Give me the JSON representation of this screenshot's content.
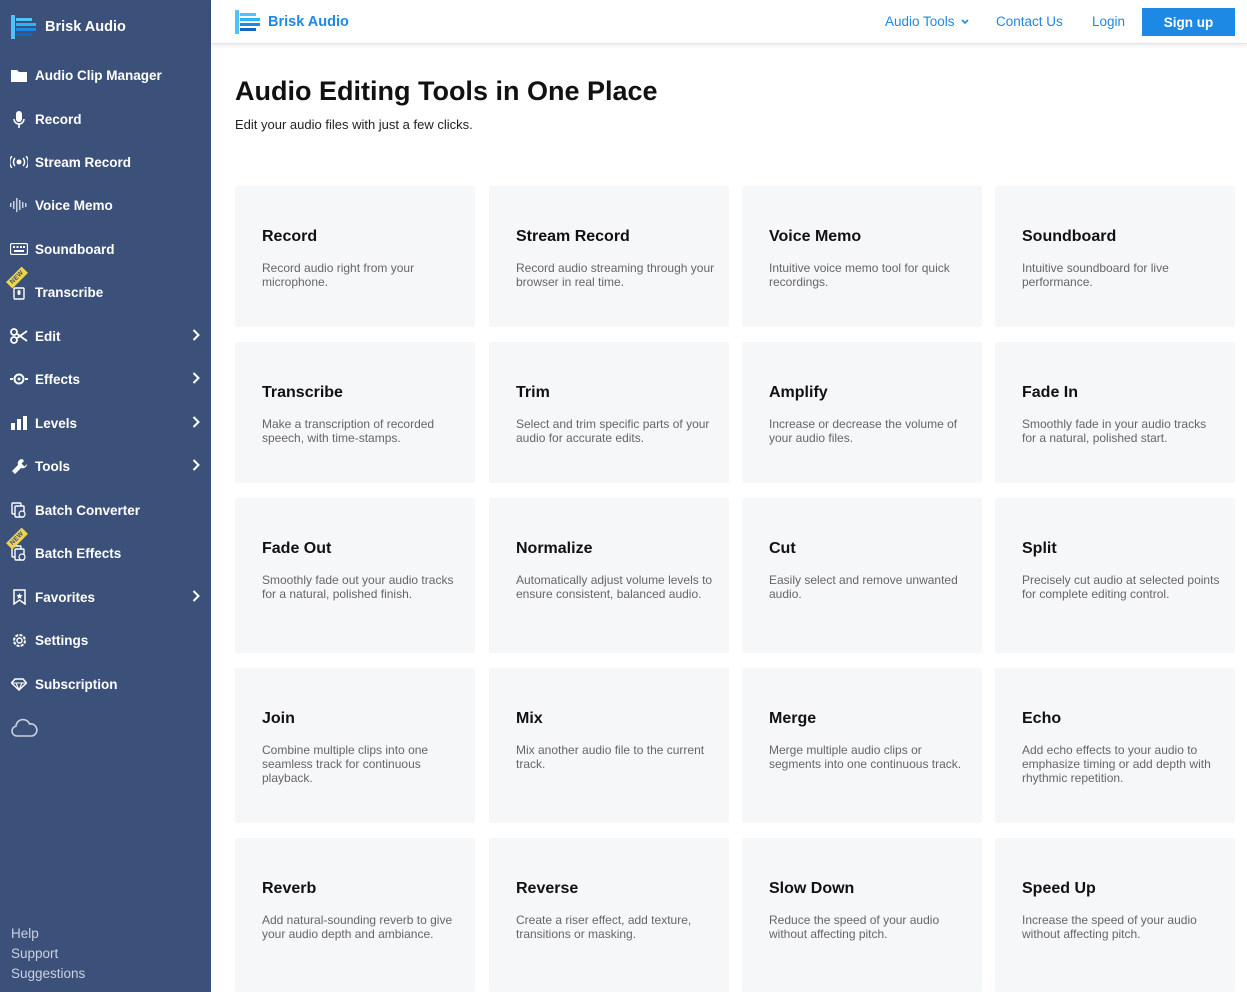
{
  "sidebar": {
    "brand": "Brisk Audio",
    "items": [
      {
        "label": "Audio Clip Manager",
        "icon": "folder-icon"
      },
      {
        "label": "Record",
        "icon": "microphone-icon"
      },
      {
        "label": "Stream Record",
        "icon": "broadcast-icon"
      },
      {
        "label": "Voice Memo",
        "icon": "waveform-icon"
      },
      {
        "label": "Soundboard",
        "icon": "keyboard-icon"
      },
      {
        "label": "Transcribe",
        "icon": "transcribe-icon",
        "badge": "NEW"
      },
      {
        "label": "Edit",
        "icon": "scissors-icon",
        "chevron": true
      },
      {
        "label": "Effects",
        "icon": "effects-icon",
        "chevron": true
      },
      {
        "label": "Levels",
        "icon": "bar-chart-icon",
        "chevron": true
      },
      {
        "label": "Tools",
        "icon": "wrench-icon",
        "chevron": true
      },
      {
        "label": "Batch Converter",
        "icon": "batch-converter-icon"
      },
      {
        "label": "Batch Effects",
        "icon": "batch-effects-icon",
        "badge": "NEW"
      },
      {
        "label": "Favorites",
        "icon": "bookmark-icon",
        "chevron": true
      },
      {
        "label": "Settings",
        "icon": "gear-icon"
      },
      {
        "label": "Subscription",
        "icon": "diamond-icon"
      }
    ],
    "footer": [
      "Help",
      "Support",
      "Suggestions"
    ]
  },
  "topnav": {
    "brand": "Brisk Audio",
    "audio_tools": "Audio Tools",
    "contact": "Contact Us",
    "login": "Login",
    "signup": "Sign up"
  },
  "main": {
    "title": "Audio Editing Tools in One Place",
    "subtitle": "Edit your audio files with just a few clicks."
  },
  "tools": [
    {
      "title": "Record",
      "desc": "Record audio right from your microphone."
    },
    {
      "title": "Stream Record",
      "desc": "Record audio streaming through your browser in real time."
    },
    {
      "title": "Voice Memo",
      "desc": "Intuitive voice memo tool for quick recordings."
    },
    {
      "title": "Soundboard",
      "desc": "Intuitive soundboard for live performance."
    },
    {
      "title": "Transcribe",
      "desc": "Make a transcription of recorded speech, with time-stamps."
    },
    {
      "title": "Trim",
      "desc": "Select and trim specific parts of your audio for accurate edits."
    },
    {
      "title": "Amplify",
      "desc": "Increase or decrease the volume of your audio files."
    },
    {
      "title": "Fade In",
      "desc": "Smoothly fade in your audio tracks for a natural, polished start."
    },
    {
      "title": "Fade Out",
      "desc": "Smoothly fade out your audio tracks for a natural, polished finish."
    },
    {
      "title": "Normalize",
      "desc": "Automatically adjust volume levels to ensure consistent, balanced audio."
    },
    {
      "title": "Cut",
      "desc": "Easily select and remove unwanted audio."
    },
    {
      "title": "Split",
      "desc": "Precisely cut audio at selected points for complete editing control."
    },
    {
      "title": "Join",
      "desc": "Combine multiple clips into one seamless track for continuous playback."
    },
    {
      "title": "Mix",
      "desc": "Mix another audio file to the current track."
    },
    {
      "title": "Merge",
      "desc": "Merge multiple audio clips or segments into one continuous track."
    },
    {
      "title": "Echo",
      "desc": "Add echo effects to your audio to emphasize timing or add depth with rhythmic repetition."
    },
    {
      "title": "Reverb",
      "desc": "Add natural-sounding reverb to give your audio depth and ambiance."
    },
    {
      "title": "Reverse",
      "desc": "Create a riser effect, add texture, transitions or masking."
    },
    {
      "title": "Slow Down",
      "desc": "Reduce the speed of your audio without affecting pitch."
    },
    {
      "title": "Speed Up",
      "desc": "Increase the speed of your audio without affecting pitch."
    }
  ],
  "colors": {
    "sidebar_bg": "#3c5179",
    "accent": "#1e88e5",
    "card_bg": "#f6f7f9",
    "new_badge": "#f0d44a"
  }
}
